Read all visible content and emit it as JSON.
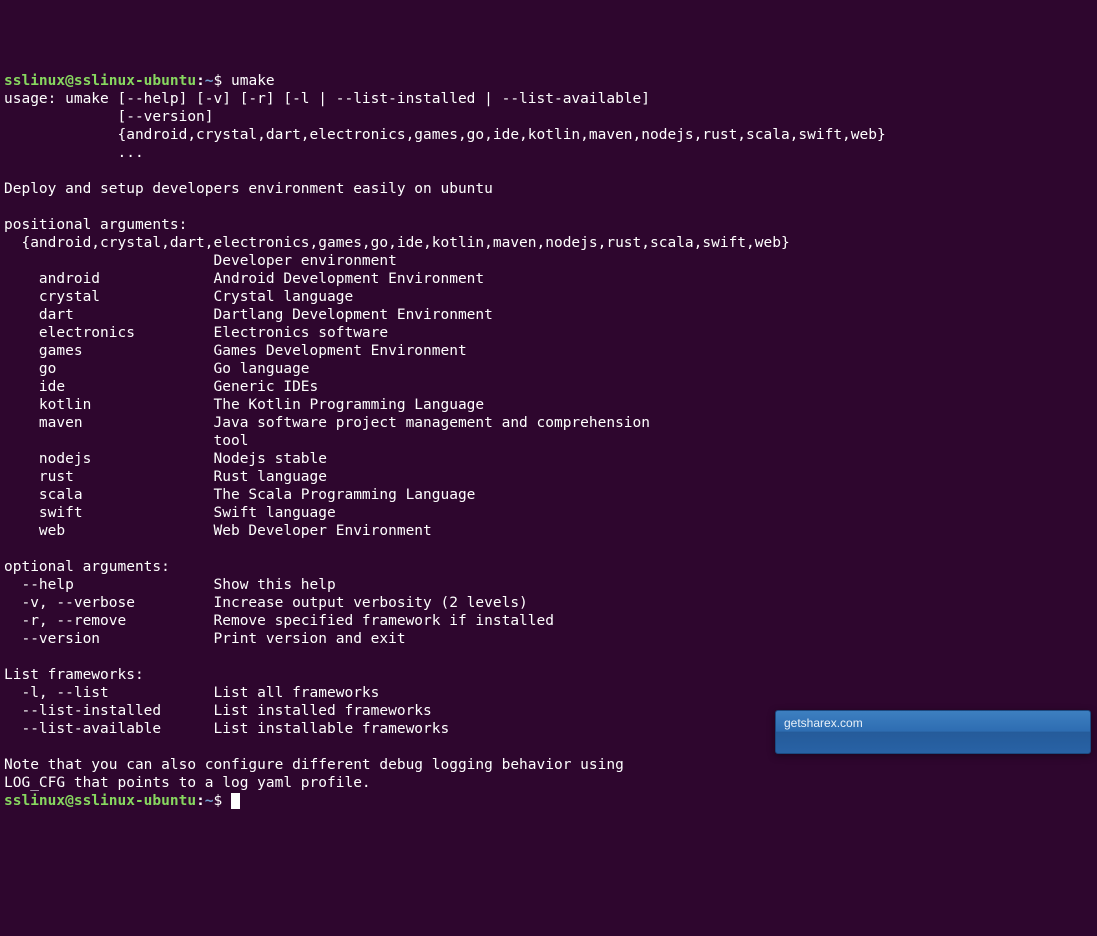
{
  "prompt": {
    "user": "sslinux",
    "host": "sslinux-ubuntu",
    "path": "~",
    "dollar": "$"
  },
  "command": "umake",
  "usage": {
    "l1": "usage: umake [--help] [-v] [-r] [-l | --list-installed | --list-available]",
    "l2": "             [--version]",
    "l3": "             {android,crystal,dart,electronics,games,go,ide,kotlin,maven,nodejs,rust,scala,swift,web}",
    "l4": "             ..."
  },
  "desc": "Deploy and setup developers environment easily on ubuntu",
  "positional": {
    "header": "positional arguments:",
    "choices": "  {android,crystal,dart,electronics,games,go,ide,kotlin,maven,nodejs,rust,scala,swift,web}",
    "choices_desc": "                        Developer environment",
    "items": [
      {
        "name": "    android             ",
        "desc": "Android Development Environment"
      },
      {
        "name": "    crystal             ",
        "desc": "Crystal language"
      },
      {
        "name": "    dart                ",
        "desc": "Dartlang Development Environment"
      },
      {
        "name": "    electronics         ",
        "desc": "Electronics software"
      },
      {
        "name": "    games               ",
        "desc": "Games Development Environment"
      },
      {
        "name": "    go                  ",
        "desc": "Go language"
      },
      {
        "name": "    ide                 ",
        "desc": "Generic IDEs"
      },
      {
        "name": "    kotlin              ",
        "desc": "The Kotlin Programming Language"
      },
      {
        "name": "    maven               ",
        "desc": "Java software project management and comprehension"
      },
      {
        "name": "                        ",
        "desc": "tool"
      },
      {
        "name": "    nodejs              ",
        "desc": "Nodejs stable"
      },
      {
        "name": "    rust                ",
        "desc": "Rust language"
      },
      {
        "name": "    scala               ",
        "desc": "The Scala Programming Language"
      },
      {
        "name": "    swift               ",
        "desc": "Swift language"
      },
      {
        "name": "    web                 ",
        "desc": "Web Developer Environment"
      }
    ]
  },
  "optional": {
    "header": "optional arguments:",
    "items": [
      {
        "flag": "  --help                ",
        "desc": "Show this help"
      },
      {
        "flag": "  -v, --verbose         ",
        "desc": "Increase output verbosity (2 levels)"
      },
      {
        "flag": "  -r, --remove          ",
        "desc": "Remove specified framework if installed"
      },
      {
        "flag": "  --version             ",
        "desc": "Print version and exit"
      }
    ]
  },
  "list": {
    "header": "List frameworks:",
    "items": [
      {
        "flag": "  -l, --list            ",
        "desc": "List all frameworks"
      },
      {
        "flag": "  --list-installed      ",
        "desc": "List installed frameworks"
      },
      {
        "flag": "  --list-available      ",
        "desc": "List installable frameworks"
      }
    ]
  },
  "note": {
    "l1": "Note that you can also configure different debug logging behavior using",
    "l2": "LOG_CFG that points to a log yaml profile."
  },
  "notification": {
    "text": "getsharex.com"
  }
}
